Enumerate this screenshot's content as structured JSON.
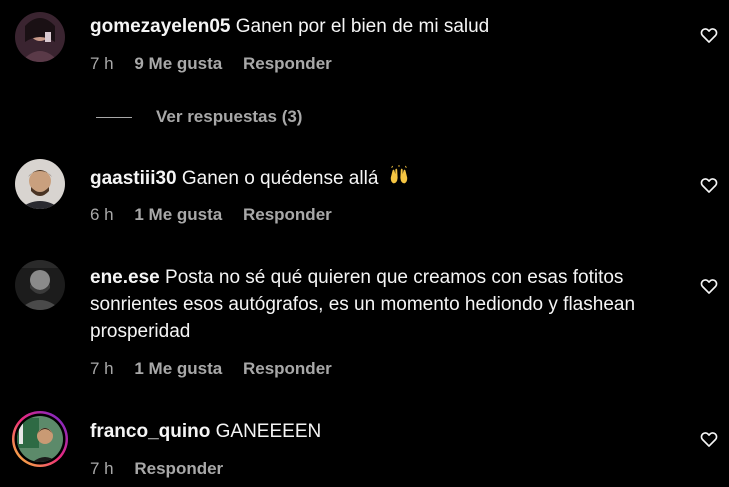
{
  "comments": [
    {
      "username": "gomezayelen05",
      "text": "Ganen por el bien de mi salud",
      "time": "7 h",
      "likes": "9 Me gusta",
      "reply": "Responder"
    },
    {
      "username": "gaastiii30",
      "text": "Ganen o quédense allá",
      "emoji": "raising-hands",
      "time": "6 h",
      "likes": "1 Me gusta",
      "reply": "Responder"
    },
    {
      "username": "ene.ese",
      "text": "Posta no sé qué quieren que creamos con esas fotitos sonrientes esos autógrafos, es un momento hediondo y flashean prosperidad",
      "time": "7 h",
      "likes": "1 Me gusta",
      "reply": "Responder"
    },
    {
      "username": "franco_quino",
      "text": "GANEEEEN",
      "time": "7 h",
      "reply": "Responder"
    }
  ],
  "view_replies": "Ver respuestas (3)",
  "icons": {
    "like": "heart-outline-icon"
  },
  "colors": {
    "background": "#000000",
    "primary_text": "#f5f5f5",
    "secondary_text": "#a8a8a8",
    "story_ring_start": "#f9ce34",
    "story_ring_end": "#ee2a7b"
  }
}
